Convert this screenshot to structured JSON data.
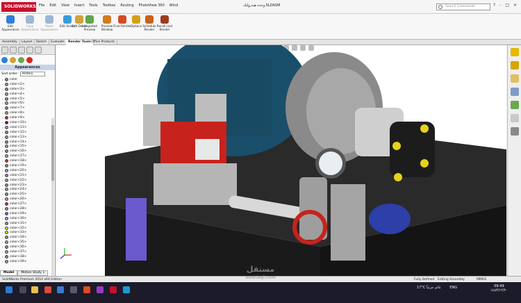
{
  "app": {
    "logo_text": "SOLIDWORKS",
    "document_title": "وحده هيدروليك.SLDASM",
    "menus": [
      "File",
      "Edit",
      "View",
      "Insert",
      "Tools",
      "Toolbox",
      "Routing",
      "PhotoView 360",
      "Wind"
    ],
    "search_placeholder": "Search Commands",
    "window_controls": [
      "?",
      "-",
      "□",
      "×"
    ]
  },
  "ribbon": {
    "buttons": [
      {
        "label": "Edit Appearance",
        "color": "#2e7fd6",
        "enabled": true
      },
      {
        "label": "Copy Appearance",
        "color": "#9bb7d4",
        "enabled": false
      },
      {
        "label": "Paste Appearance",
        "color": "#9bb7d4",
        "enabled": false
      },
      {
        "label": "Edit Scene",
        "color": "#3a9bd8",
        "enabled": true
      },
      {
        "label": "Edit Decal",
        "color": "#d0a23a",
        "enabled": true
      },
      {
        "label": "Integrated Preview",
        "color": "#5fa64a",
        "enabled": true
      },
      {
        "label": "Preview Window",
        "color": "#d17b1f",
        "enabled": true
      },
      {
        "label": "Final Render",
        "color": "#d84a22",
        "enabled": true
      },
      {
        "label": "Options",
        "color": "#d4a017",
        "enabled": true
      },
      {
        "label": "Schedule Render",
        "color": "#c9611a",
        "enabled": true
      },
      {
        "label": "Recall Last Render",
        "color": "#a03a20",
        "enabled": true
      }
    ]
  },
  "tabs": [
    {
      "label": "Assembly",
      "active": false
    },
    {
      "label": "Layout",
      "active": false
    },
    {
      "label": "Sketch",
      "active": false
    },
    {
      "label": "Evaluate",
      "active": false
    },
    {
      "label": "Render Tools",
      "active": true
    },
    {
      "label": "Office Products",
      "active": false
    }
  ],
  "panel": {
    "header": "Appearances",
    "sort_label": "Sort order:",
    "sort_value": "History",
    "colors": [
      {
        "name": "color",
        "swatch": "#888888"
      },
      {
        "name": "color<2>",
        "swatch": "#9a9a9a"
      },
      {
        "name": "color<3>",
        "swatch": "#8a8a8a"
      },
      {
        "name": "color<4>",
        "swatch": "#9a9a9a"
      },
      {
        "name": "color<5>",
        "swatch": "#8c8c8c"
      },
      {
        "name": "color<6>",
        "swatch": "#999999"
      },
      {
        "name": "color<7>",
        "swatch": "#888888"
      },
      {
        "name": "color<8>",
        "swatch": "#9a9a9a"
      },
      {
        "name": "color<9>",
        "swatch": "#d9261c"
      },
      {
        "name": "color<10>",
        "swatch": "#2a2a7a"
      },
      {
        "name": "color<11>",
        "swatch": "#9a9a9a"
      },
      {
        "name": "color<12>",
        "swatch": "#8a8a8a"
      },
      {
        "name": "color<13>",
        "swatch": "#999999"
      },
      {
        "name": "color<14>",
        "swatch": "#888888"
      },
      {
        "name": "color<15>",
        "swatch": "#9a9a9a"
      },
      {
        "name": "color<16>",
        "swatch": "#8a8a8a"
      },
      {
        "name": "color<17>",
        "swatch": "#9a9a9a"
      },
      {
        "name": "color<18>",
        "swatch": "#d9261c"
      },
      {
        "name": "color<19>",
        "swatch": "#888888"
      },
      {
        "name": "color<20>",
        "swatch": "#999999"
      },
      {
        "name": "color<21>",
        "swatch": "#8a8a8a"
      },
      {
        "name": "color<22>",
        "swatch": "#9a9a9a"
      },
      {
        "name": "color<23>",
        "swatch": "#888888"
      },
      {
        "name": "color<24>",
        "swatch": "#999999"
      },
      {
        "name": "color<25>",
        "swatch": "#8a8a8a"
      },
      {
        "name": "color<26>",
        "swatch": "#9a9a9a"
      },
      {
        "name": "color<27>",
        "swatch": "#d9261c"
      },
      {
        "name": "color<28>",
        "swatch": "#888888"
      },
      {
        "name": "color<29>",
        "swatch": "#6a5acd"
      },
      {
        "name": "color<30>",
        "swatch": "#999999"
      },
      {
        "name": "color<31>",
        "swatch": "#8a8a8a"
      },
      {
        "name": "color<32>",
        "swatch": "#e6d21c"
      },
      {
        "name": "color<33>",
        "swatch": "#e6d21c"
      },
      {
        "name": "color<34>",
        "swatch": "#888888"
      },
      {
        "name": "color<35>",
        "swatch": "#9a9a9a"
      },
      {
        "name": "color<36>",
        "swatch": "#8a8a8a"
      },
      {
        "name": "color<37>",
        "swatch": "#999999"
      },
      {
        "name": "color<38>",
        "swatch": "#888888"
      },
      {
        "name": "color<39>",
        "swatch": "#9a9a9a"
      }
    ],
    "bottom_tabs": [
      {
        "label": "Model",
        "active": true
      },
      {
        "label": "Motion Study 1",
        "active": false
      }
    ]
  },
  "status": {
    "edition": "SolidWorks Premium 2014 x64 Edition",
    "defined": "Fully Defined",
    "mode": "Editing Assembly",
    "units": "MMGS"
  },
  "taskbar": {
    "weather": "17°C",
    "weather_text": "غائم جزئياً",
    "lang": "ENG",
    "time": "09:49",
    "date": "١٤٤٣/١٢/٢٠"
  },
  "watermark": {
    "arabic": "مستقل",
    "latin": "mostaql.com"
  },
  "colors": {
    "motor_blue": "#1a4f6b",
    "valve_red": "#c8221c",
    "tank_black": "#1e1e1e",
    "brand_red": "#c8102e"
  }
}
